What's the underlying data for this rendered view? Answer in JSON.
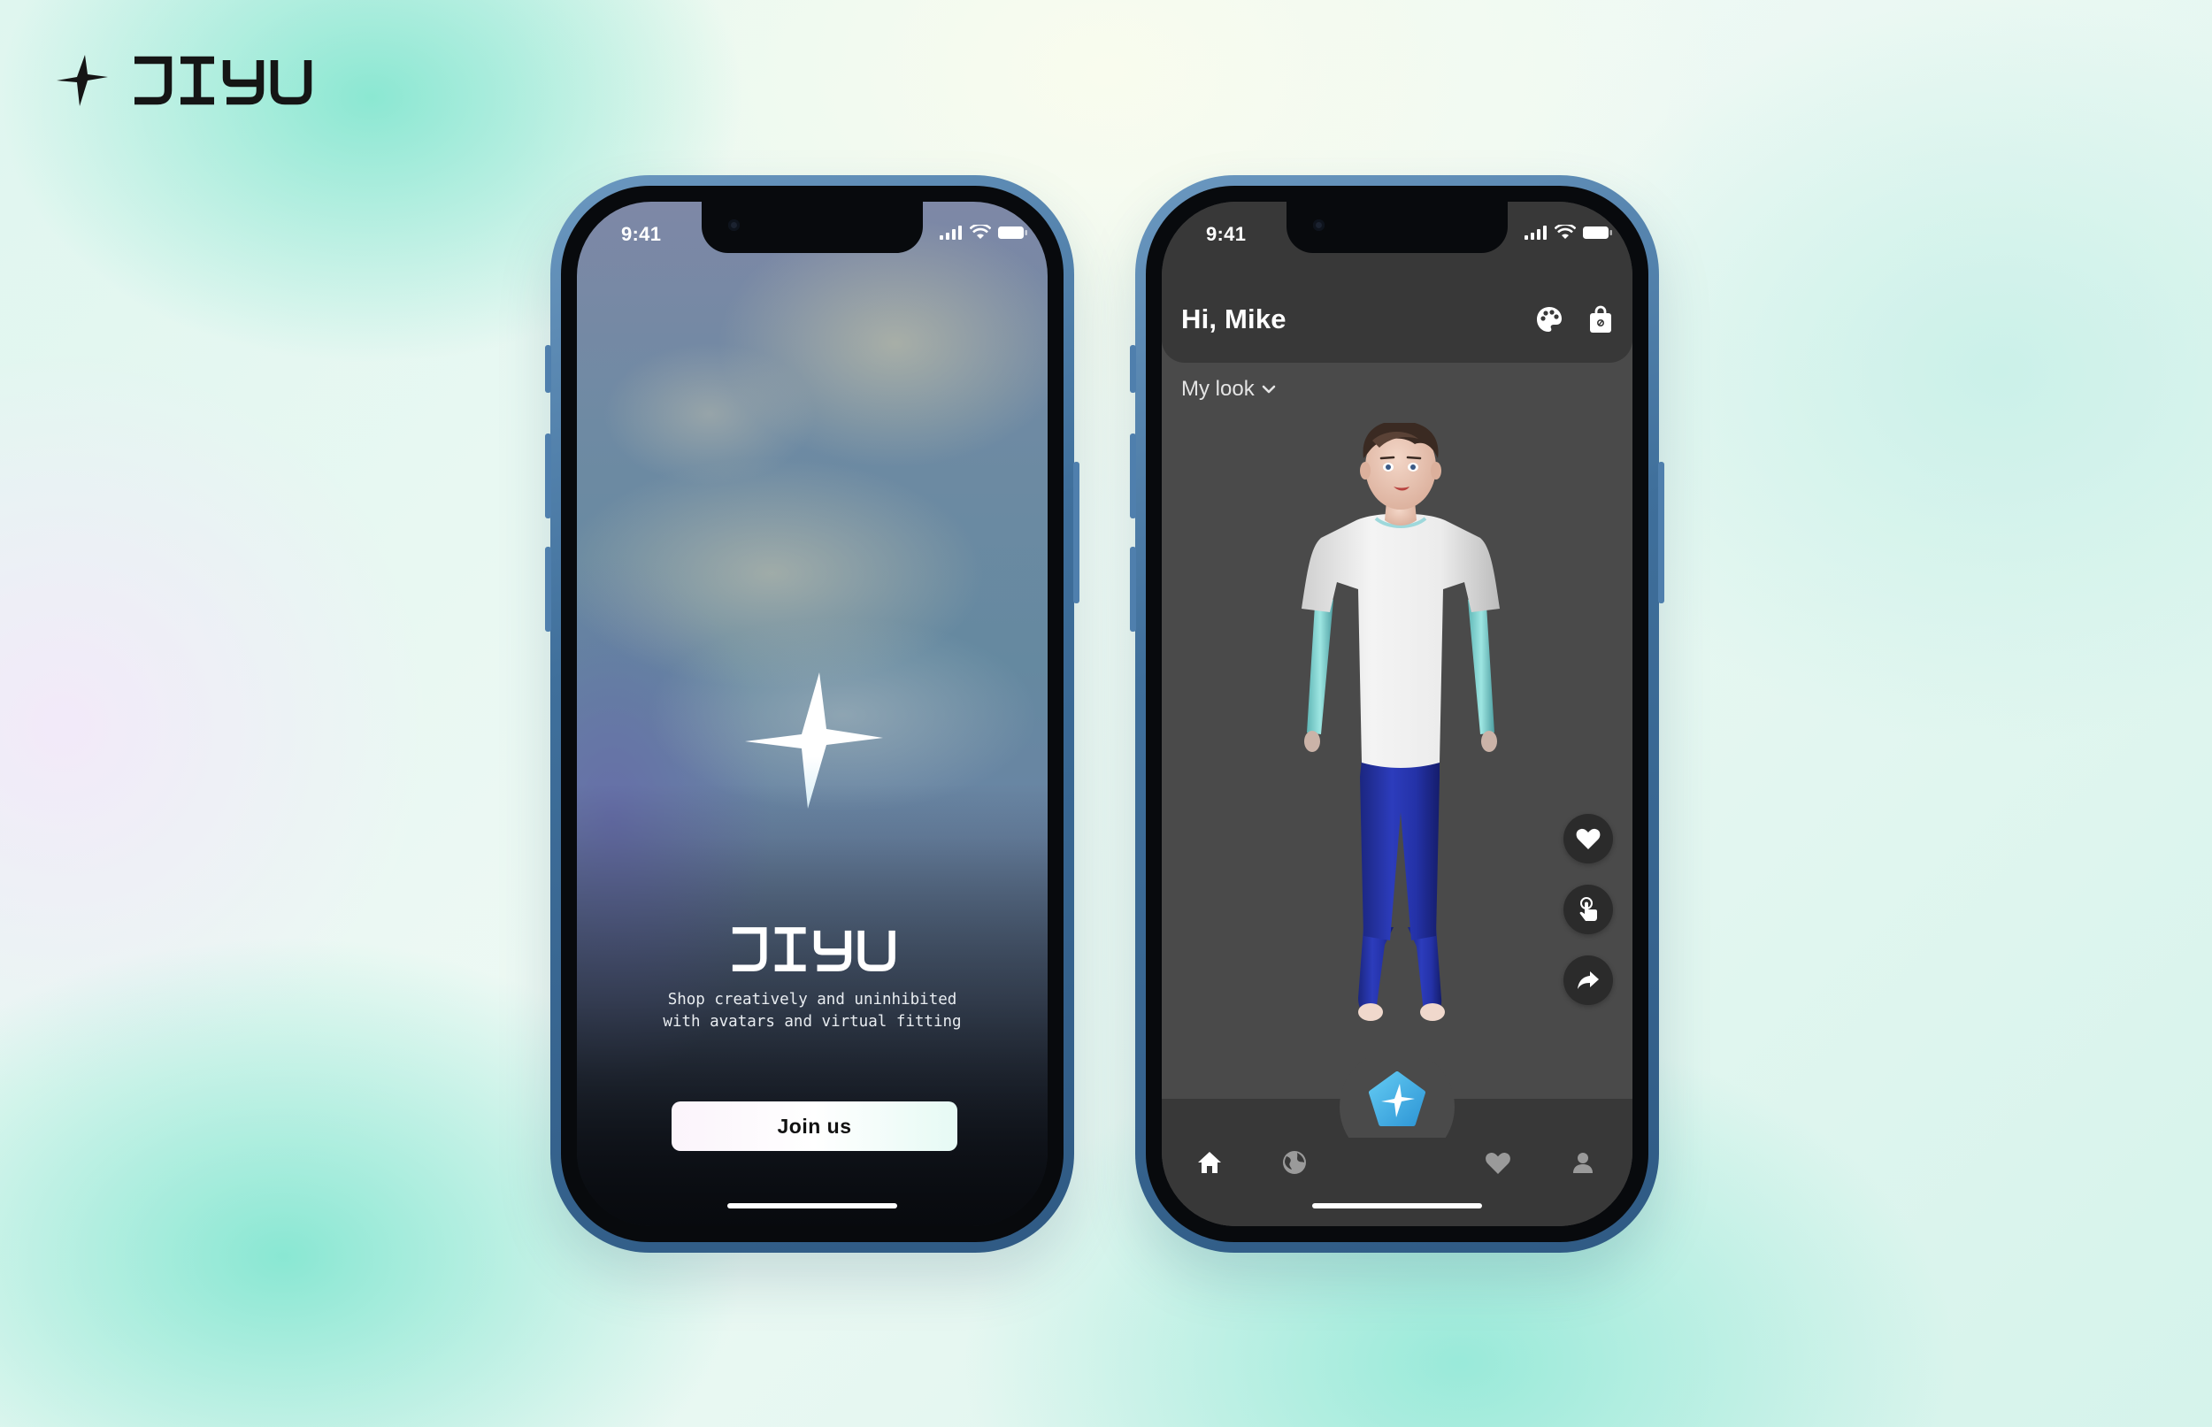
{
  "brand": {
    "name": "JIYU"
  },
  "colors": {
    "accent": "#4ab8e8",
    "mint": "#7fe3cf",
    "dark_surface": "#383838",
    "screen_bg": "#4a4a4a"
  },
  "phone_welcome": {
    "status": {
      "time": "9:41"
    },
    "wordmark": "JIYU",
    "tagline_line1": "Shop creatively and uninhibited",
    "tagline_line2": "with avatars and virtual fitting",
    "join_label": "Join us"
  },
  "phone_home": {
    "status": {
      "time": "9:41"
    },
    "greeting": "Hi, Mike",
    "header_icons": [
      "palette-icon",
      "shopping-bag-icon"
    ],
    "look_selector": "My look",
    "action_buttons": [
      "heart-icon",
      "touch-icon",
      "share-icon"
    ],
    "nav_items": [
      "home-icon",
      "globe-icon",
      "sparkle-icon",
      "heart-icon",
      "profile-icon"
    ]
  }
}
